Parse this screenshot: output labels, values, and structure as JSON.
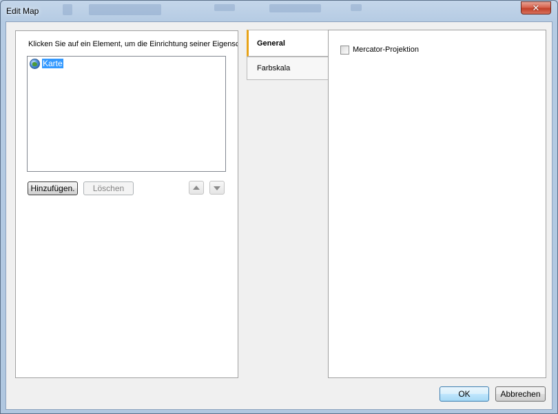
{
  "window": {
    "title": "Edit Map",
    "close_label": "✕"
  },
  "left_panel": {
    "instruction": "Klicken Sie auf ein Element, um die Einrichtung seiner Eigenscha",
    "list_items": [
      {
        "label": "Karte",
        "icon": "globe-icon",
        "selected": true
      }
    ],
    "add_button": "Hinzufügen.",
    "delete_button": "Löschen",
    "move_up_icon": "up-arrow-icon",
    "move_down_icon": "down-arrow-icon"
  },
  "tabs": [
    {
      "label": "General",
      "active": true
    },
    {
      "label": "Farbskala",
      "active": false
    }
  ],
  "general": {
    "mercator_label": "Mercator-Projektion",
    "mercator_checked": false
  },
  "footer": {
    "ok_label": "OK",
    "cancel_label": "Abbrechen"
  },
  "colors": {
    "selection": "#3399ff",
    "active_tab_accent": "#e8a317",
    "close_button": "#c2412a"
  }
}
